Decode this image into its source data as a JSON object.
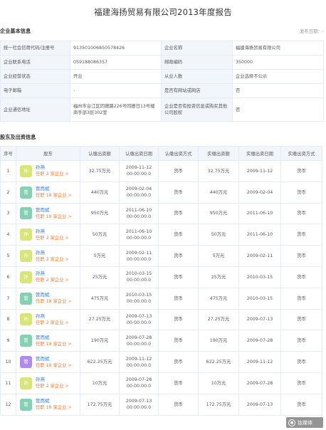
{
  "title": "福建海扬贸易有限公司2013年度报告",
  "basic": {
    "heading": "企业基本信息",
    "publish_date": "发布日期：-",
    "rows": [
      [
        "统一社会信用代码/注册号",
        "913501006850578426",
        "企业名称",
        "福建海扬贸易有限公司"
      ],
      [
        "企业联系电话",
        "059188086357",
        "邮政编码",
        "350000"
      ],
      [
        "企业经营状态",
        "开业",
        "从业人数",
        "企业选择不公示"
      ],
      [
        "电子邮箱",
        "-",
        "是否有网站或网店",
        "否"
      ],
      [
        "企业通信地址",
        "福州市台江区同德路226号同德日13号楼商手部3层302室",
        "企业是否有投资信息或购买其他公司股权",
        "否"
      ]
    ]
  },
  "shareholders": {
    "heading": "股东及出资信息",
    "columns": [
      "序号",
      "股东",
      "认缴出资额",
      "认缴出资日期",
      "认缴出资方式",
      "实缴出资额",
      "实缴出资日期",
      "实缴出资方式"
    ],
    "rows": [
      {
        "no": "1",
        "avatar": "孙",
        "name": "孙燕",
        "sub": "任职 2 家企业 >",
        "sub_amt": "32.75万元",
        "sub_date": "2009-11-12 00:00:00.0",
        "sub_way": "货币",
        "paid_amt": "32.75万元",
        "paid_date": "2009-11-12",
        "paid_way": "货币"
      },
      {
        "no": "2",
        "avatar": "管",
        "name": "管而斌",
        "sub": "任职 18 家企业 >",
        "sub_amt": "440万元",
        "sub_date": "2009-02-04 00:00:00.0",
        "sub_way": "货币",
        "paid_amt": "440万元",
        "paid_date": "2009-02-04",
        "paid_way": "货币"
      },
      {
        "no": "3",
        "avatar": "管",
        "name": "管而斌",
        "sub": "任职 18 家企业 >",
        "sub_amt": "950万元",
        "sub_date": "2011-06-10 00:00:00.0",
        "sub_way": "货币",
        "paid_amt": "950万元",
        "paid_date": "2011-06-10",
        "paid_way": "货币"
      },
      {
        "no": "4",
        "avatar": "孙",
        "name": "孙燕",
        "sub": "任职 2 家企业 >",
        "sub_amt": "50万元",
        "sub_date": "2011-06-10 00:00:00.0",
        "sub_way": "货币",
        "paid_amt": "50万元",
        "paid_date": "2011-06-10",
        "paid_way": "货币"
      },
      {
        "no": "5",
        "avatar": "孙",
        "name": "孙燕",
        "sub": "任职 2 家企业 >",
        "sub_amt": "5万元",
        "sub_date": "2009-02-11 00:00:00.0",
        "sub_way": "货币",
        "paid_amt": "5万元",
        "paid_date": "2009-02-11",
        "paid_way": "货币"
      },
      {
        "no": "6",
        "avatar": "孙",
        "name": "孙燕",
        "sub": "任职 2 家企业 >",
        "sub_amt": "25万元",
        "sub_date": "2010-03-15 00:00:00.0",
        "sub_way": "货币",
        "paid_amt": "25万元",
        "paid_date": "2010-03-15",
        "paid_way": "货币"
      },
      {
        "no": "7",
        "avatar": "管",
        "name": "管而斌",
        "sub": "任职 18 家企业 >",
        "sub_amt": "475万元",
        "sub_date": "2010-03-15 00:00:00.0",
        "sub_way": "货币",
        "paid_amt": "475万元",
        "paid_date": "2010-03-15",
        "paid_way": "货币"
      },
      {
        "no": "8",
        "avatar": "孙",
        "name": "孙燕",
        "sub": "任职 2 家企业 >",
        "sub_amt": "27.25万元",
        "sub_date": "2009-07-13 00:00:00.0",
        "sub_way": "货币",
        "paid_amt": "27.25万元",
        "paid_date": "2009-07-13",
        "paid_way": "货币"
      },
      {
        "no": "9",
        "avatar": "管",
        "name": "管而斌",
        "sub": "任职 18 家企业 >",
        "sub_amt": "190万元",
        "sub_date": "2009-07-28 00:00:00.0",
        "sub_way": "货币",
        "paid_amt": "190万元",
        "paid_date": "2009-07-28",
        "paid_way": "货币"
      },
      {
        "no": "10",
        "avatar": "管",
        "name": "管而斌",
        "sub": "任职 18 家企业 >",
        "sub_amt": "622.25万元",
        "sub_date": "2009-11-12 00:00:00.0",
        "sub_way": "货币",
        "paid_amt": "622.25万元",
        "paid_date": "2009-11-12",
        "paid_way": "货币"
      },
      {
        "no": "11",
        "avatar": "孙",
        "name": "孙燕",
        "sub": "任职 2 家企业 >",
        "sub_amt": "10万元",
        "sub_date": "2009-07-28 00:00:00.0",
        "sub_way": "货币",
        "paid_amt": "10万元",
        "paid_date": "2009-07-28",
        "paid_way": "货币"
      },
      {
        "no": "12",
        "avatar": "管",
        "name": "管而斌",
        "sub": "任职 18 家企业 >",
        "sub_amt": "172.75万元",
        "sub_date": "2009-07-13 00:00:00.0",
        "sub_way": "货币",
        "paid_amt": "172.75万元",
        "paid_date": "2009-07-13",
        "paid_way": "货币"
      }
    ]
  },
  "watermark": "钛媒体",
  "colors": {
    "link": "#2e7bd6",
    "accent_orange": "#ff7a2a",
    "header_bg": "#f2f6fb",
    "border": "#e4ebf3"
  }
}
